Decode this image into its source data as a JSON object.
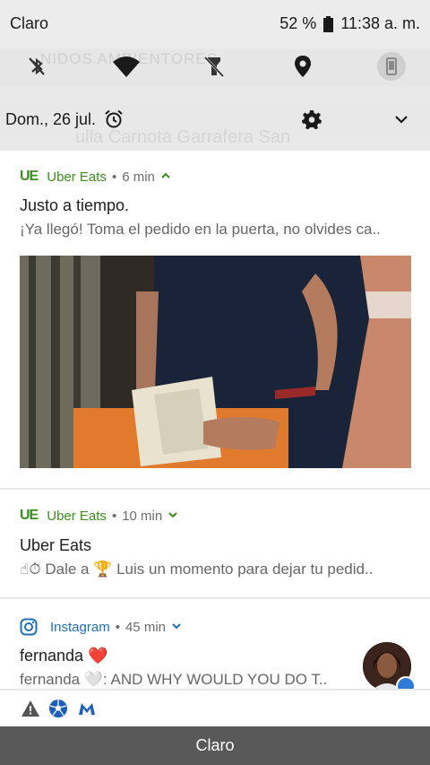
{
  "status_bar": {
    "carrier": "Claro",
    "battery": "52 %",
    "time": "11:38 a. m."
  },
  "quick_settings": {
    "icons": [
      "bluetooth-off-icon",
      "wifi-icon",
      "flashlight-off-icon",
      "location-icon",
      "auto-rotate-icon"
    ],
    "ghost_text": "NIDOS AMBIENTORES"
  },
  "date_row": {
    "date": "Dom., 26 jul."
  },
  "background_ghost_title": "ulla Carnota Garrafera San",
  "notifications": [
    {
      "app": "Uber Eats",
      "logo": "UE",
      "time": "6 min",
      "expanded": true,
      "title": "Justo a tiempo.",
      "body": "¡Ya llegó! Toma el pedido en la puerta, no olvides ca.."
    },
    {
      "app": "Uber Eats",
      "logo": "UE",
      "time": "10 min",
      "expanded": false,
      "title": "Uber Eats",
      "body": "☝⏱ Dale a 🏆 Luis un momento para dejar tu pedid.."
    },
    {
      "app": "Instagram",
      "time": "45 min",
      "expanded": false,
      "title": "fernanda ❤️",
      "body": "fernanda 🤍: AND WHY WOULD YOU DO T.."
    }
  ],
  "bottom_icons": [
    "warning-icon",
    "soccer-ball-icon",
    "malwarebytes-icon"
  ],
  "nav_bar": {
    "carrier": "Claro"
  },
  "colors": {
    "uber_green": "#3b8d1e",
    "instagram_blue": "#1c6fb8",
    "nav_bar": "#595959"
  }
}
